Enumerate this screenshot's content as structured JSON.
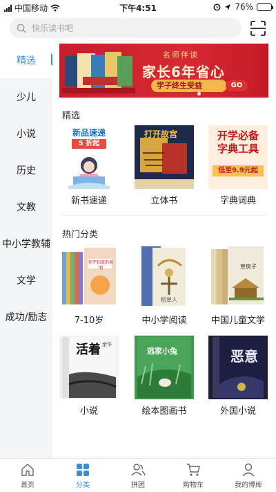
{
  "status": {
    "carrier": "中国移动",
    "time": "下午4:51",
    "battery": "76%",
    "battery_level": 0.76
  },
  "search": {
    "placeholder": "快乐读书吧"
  },
  "sidebar": {
    "items": [
      {
        "label": "精选"
      },
      {
        "label": "少儿"
      },
      {
        "label": "小说"
      },
      {
        "label": "历史"
      },
      {
        "label": "文教"
      },
      {
        "label": "中小学教辅"
      },
      {
        "label": "文学"
      },
      {
        "label": "成功/励志"
      }
    ]
  },
  "banner": {
    "subtitle": "名师伴读",
    "headline": "家长6年省心",
    "slogan": "学子终生受益",
    "go": "GO"
  },
  "featured": {
    "title": "精选",
    "items": [
      {
        "label": "新书速递",
        "cover_title": "新品速递",
        "cover_badge": "5 折起"
      },
      {
        "label": "立体书",
        "cover_title": "打开故宫"
      },
      {
        "label": "字典词典",
        "cover_title": "开学必备 字典工具",
        "cover_badge": "低至9.9元起"
      }
    ]
  },
  "hot": {
    "title": "热门分类",
    "items": [
      {
        "label": "7-10岁",
        "cover_title": "你不知道的发明"
      },
      {
        "label": "中小学阅读",
        "cover_title": "稻草人"
      },
      {
        "label": "中国儿童文学",
        "cover_title": "草房子"
      },
      {
        "label": "小说",
        "cover_title": "活着",
        "cover_author": "余华"
      },
      {
        "label": "绘本图画书",
        "cover_title": "逃家小兔"
      },
      {
        "label": "外国小说",
        "cover_title": "恶意"
      }
    ]
  },
  "tabbar": {
    "items": [
      {
        "label": "首页"
      },
      {
        "label": "分类"
      },
      {
        "label": "拼团"
      },
      {
        "label": "购物车"
      },
      {
        "label": "我的博库"
      }
    ]
  },
  "colors": {
    "accent": "#3a8ede",
    "banner_red": "#c51e2a",
    "sidebar_bg": "#f4f5f7"
  }
}
